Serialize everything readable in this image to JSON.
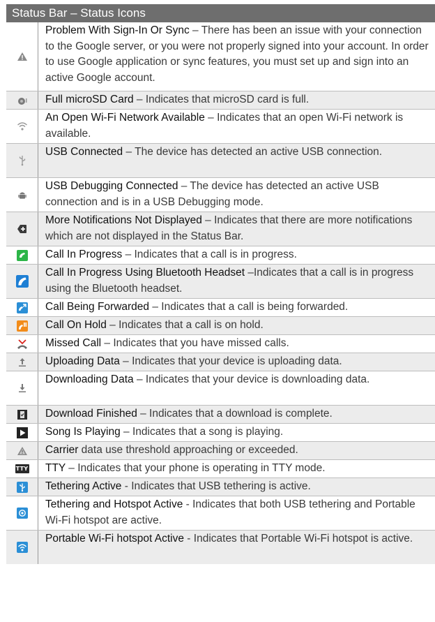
{
  "header": {
    "title": "Status Bar – Status Icons"
  },
  "rows": [
    {
      "term": "Problem With Sign-In Or Sync",
      "desc": " – There has been an issue with your connection to the Google server, or you were not properly signed into your account. In order to use Google application or sync features, you must set up and sign into an active Google account.",
      "icon": "sync-problem-warning-icon"
    },
    {
      "term": "Full microSD Card",
      "desc": " – Indicates that microSD card is full.",
      "icon": "microsd-full-icon"
    },
    {
      "term": "An Open Wi-Fi Network Available",
      "desc": " – Indicates that an open Wi-Fi network is available.",
      "icon": "open-wifi-icon"
    },
    {
      "term": "USB Connected",
      "desc": " – The device has detected an active USB connection.",
      "icon": "usb-icon"
    },
    {
      "term": "USB Debugging Connected",
      "desc": " – The device has detected an active USB connection and is in a USB Debugging mode.",
      "icon": "usb-debugging-android-icon"
    },
    {
      "term": "More Notifications Not Displayed",
      "desc": " – Indicates that there are more notifications which are not displayed in the Status Bar.",
      "icon": "more-notifications-icon"
    },
    {
      "term": "Call In Progress",
      "desc": " – Indicates that a call is in progress.",
      "icon": "call-in-progress-icon"
    },
    {
      "term": "Call In Progress Using Bluetooth Headset",
      "desc": " –Indicates that a call is in progress using the Bluetooth headset.",
      "icon": "bluetooth-call-icon"
    },
    {
      "term": "Call Being Forwarded",
      "desc": " – Indicates that a call is being forwarded.",
      "icon": "call-forwarded-icon"
    },
    {
      "term": "Call On Hold",
      "desc": " – Indicates that a call is on hold.",
      "icon": "call-on-hold-icon"
    },
    {
      "term": "Missed Call",
      "desc": " – Indicates that you have missed calls.",
      "icon": "missed-call-icon"
    },
    {
      "term": "Uploading Data",
      "desc": " – Indicates that your device is uploading data.",
      "icon": "upload-arrow-icon"
    },
    {
      "term": "Downloading Data",
      "desc": " – Indicates that your device is downloading data.",
      "icon": "download-arrow-icon"
    },
    {
      "term": "Download Finished",
      "desc": " – Indicates that a download is complete.",
      "icon": "download-finished-icon"
    },
    {
      "term": "Song Is Playing",
      "desc": " – Indicates that a song is playing.",
      "icon": "play-icon"
    },
    {
      "term": "Carrier",
      "desc": " data use threshold approaching or exceeded.",
      "icon": "data-warning-icon"
    },
    {
      "term": "TTY",
      "desc": " – Indicates that your phone is operating in TTY mode.",
      "icon": "tty-icon",
      "icon_label": "TTY"
    },
    {
      "term": "Tethering Active",
      "desc": " - Indicates that USB tethering is active.",
      "icon": "usb-tethering-icon"
    },
    {
      "term": "Tethering and Hotspot Active",
      "desc": " - Indicates that both USB tethering and Portable Wi-Fi hotspot are active.",
      "icon": "tethering-hotspot-icon"
    },
    {
      "term": "Portable Wi-Fi hotspot Active",
      "desc": " - Indicates that Portable Wi-Fi hotspot is active.",
      "icon": "wifi-hotspot-icon"
    }
  ]
}
